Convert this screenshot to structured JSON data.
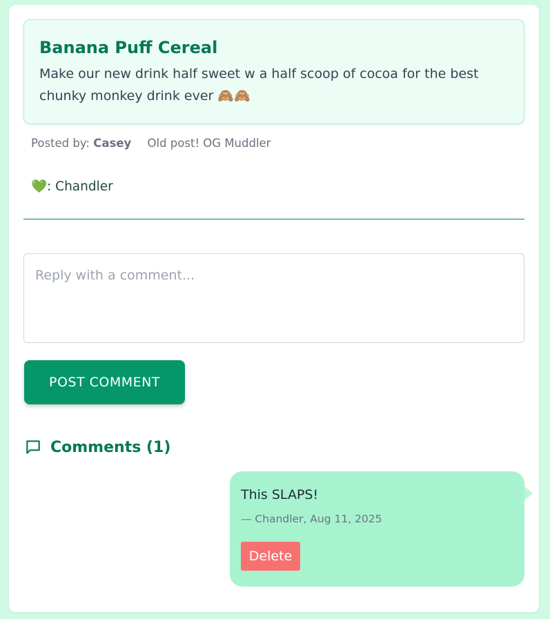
{
  "post": {
    "title": "Banana Puff Cereal",
    "body": "Make our new drink half sweet w a half scoop of cocoa for the best chunky monkey drink ever 🙈🙈",
    "posted_by_label": "Posted by:",
    "author": "Casey",
    "badge": "Old post! OG Muddler",
    "likes": "💚: Chandler"
  },
  "reply": {
    "placeholder": "Reply with a comment...",
    "value": "",
    "submit_label": "POST COMMENT"
  },
  "comments_section": {
    "title": "Comments (1)",
    "icon": "comment-icon",
    "items": [
      {
        "text": "This SLAPS!",
        "meta": "— Chandler, Aug 11, 2025",
        "delete_label": "Delete"
      }
    ]
  },
  "colors": {
    "background": "#d1fae5",
    "accent": "#047857",
    "button": "#059669",
    "bubble": "#a7f3d0",
    "delete": "#f87171"
  }
}
